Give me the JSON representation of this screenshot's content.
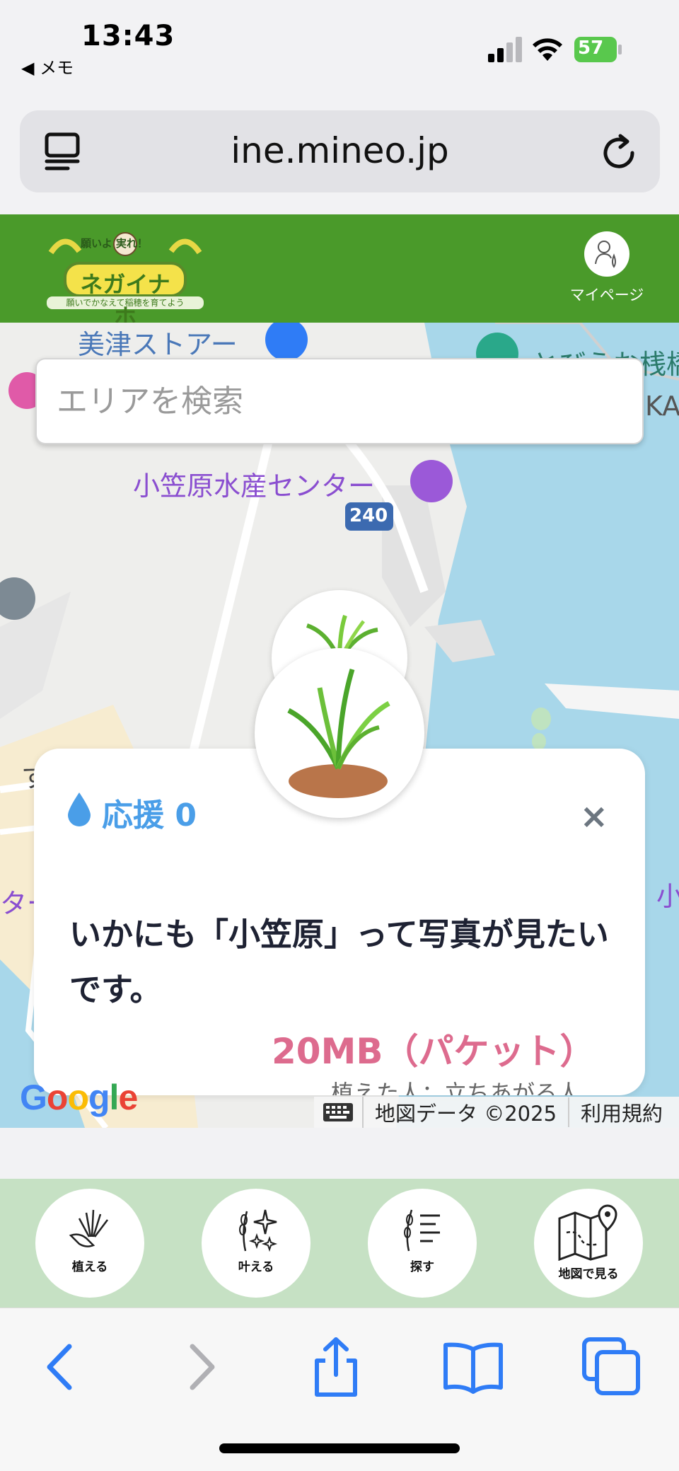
{
  "status_bar": {
    "time": "13:43",
    "back_app": "◀ メモ",
    "battery_level": "57"
  },
  "browser": {
    "url": "ine.mineo.jp"
  },
  "site_header": {
    "logo_tagline": "願いよ 実れ！",
    "logo_title": "ネガイナホ",
    "logo_subtitle": "願いでかなえて稲穂を育てよう",
    "mypage_label": "マイページ"
  },
  "map": {
    "search_placeholder": "エリアを検索",
    "labels": {
      "store": "美津ストアー",
      "suisan": "小笠原水産センター",
      "route": "240",
      "right_partial": "とびうお桟橋",
      "right_kana": "KA",
      "left_su": "す",
      "left_ta": "ター",
      "right_ko": "小"
    },
    "google": "Google",
    "map_data": "地図データ ©2025",
    "terms": "利用規約"
  },
  "popup": {
    "cheer_label": "応援 0",
    "close": "×",
    "wish_text": "いかにも「小笠原」って写真が見たいです。",
    "reward": "20MB（パケット）",
    "planter": "植えた人：立ちあがる人"
  },
  "site_nav": {
    "items": [
      {
        "label": "植える",
        "icon": "planting-hand-icon"
      },
      {
        "label": "叶える",
        "icon": "sparkle-rice-icon"
      },
      {
        "label": "探す",
        "icon": "search-list-icon"
      },
      {
        "label": "地図で見る",
        "icon": "map-pin-icon"
      }
    ]
  },
  "colors": {
    "header_green": "#4a9a2a",
    "nav_green": "#c6e1c4",
    "cheer_blue": "#4a9ee8",
    "reward_pink": "#dd6b8e",
    "sea_blue": "#a8d7ea",
    "ios_blue": "#2f7cf6"
  }
}
